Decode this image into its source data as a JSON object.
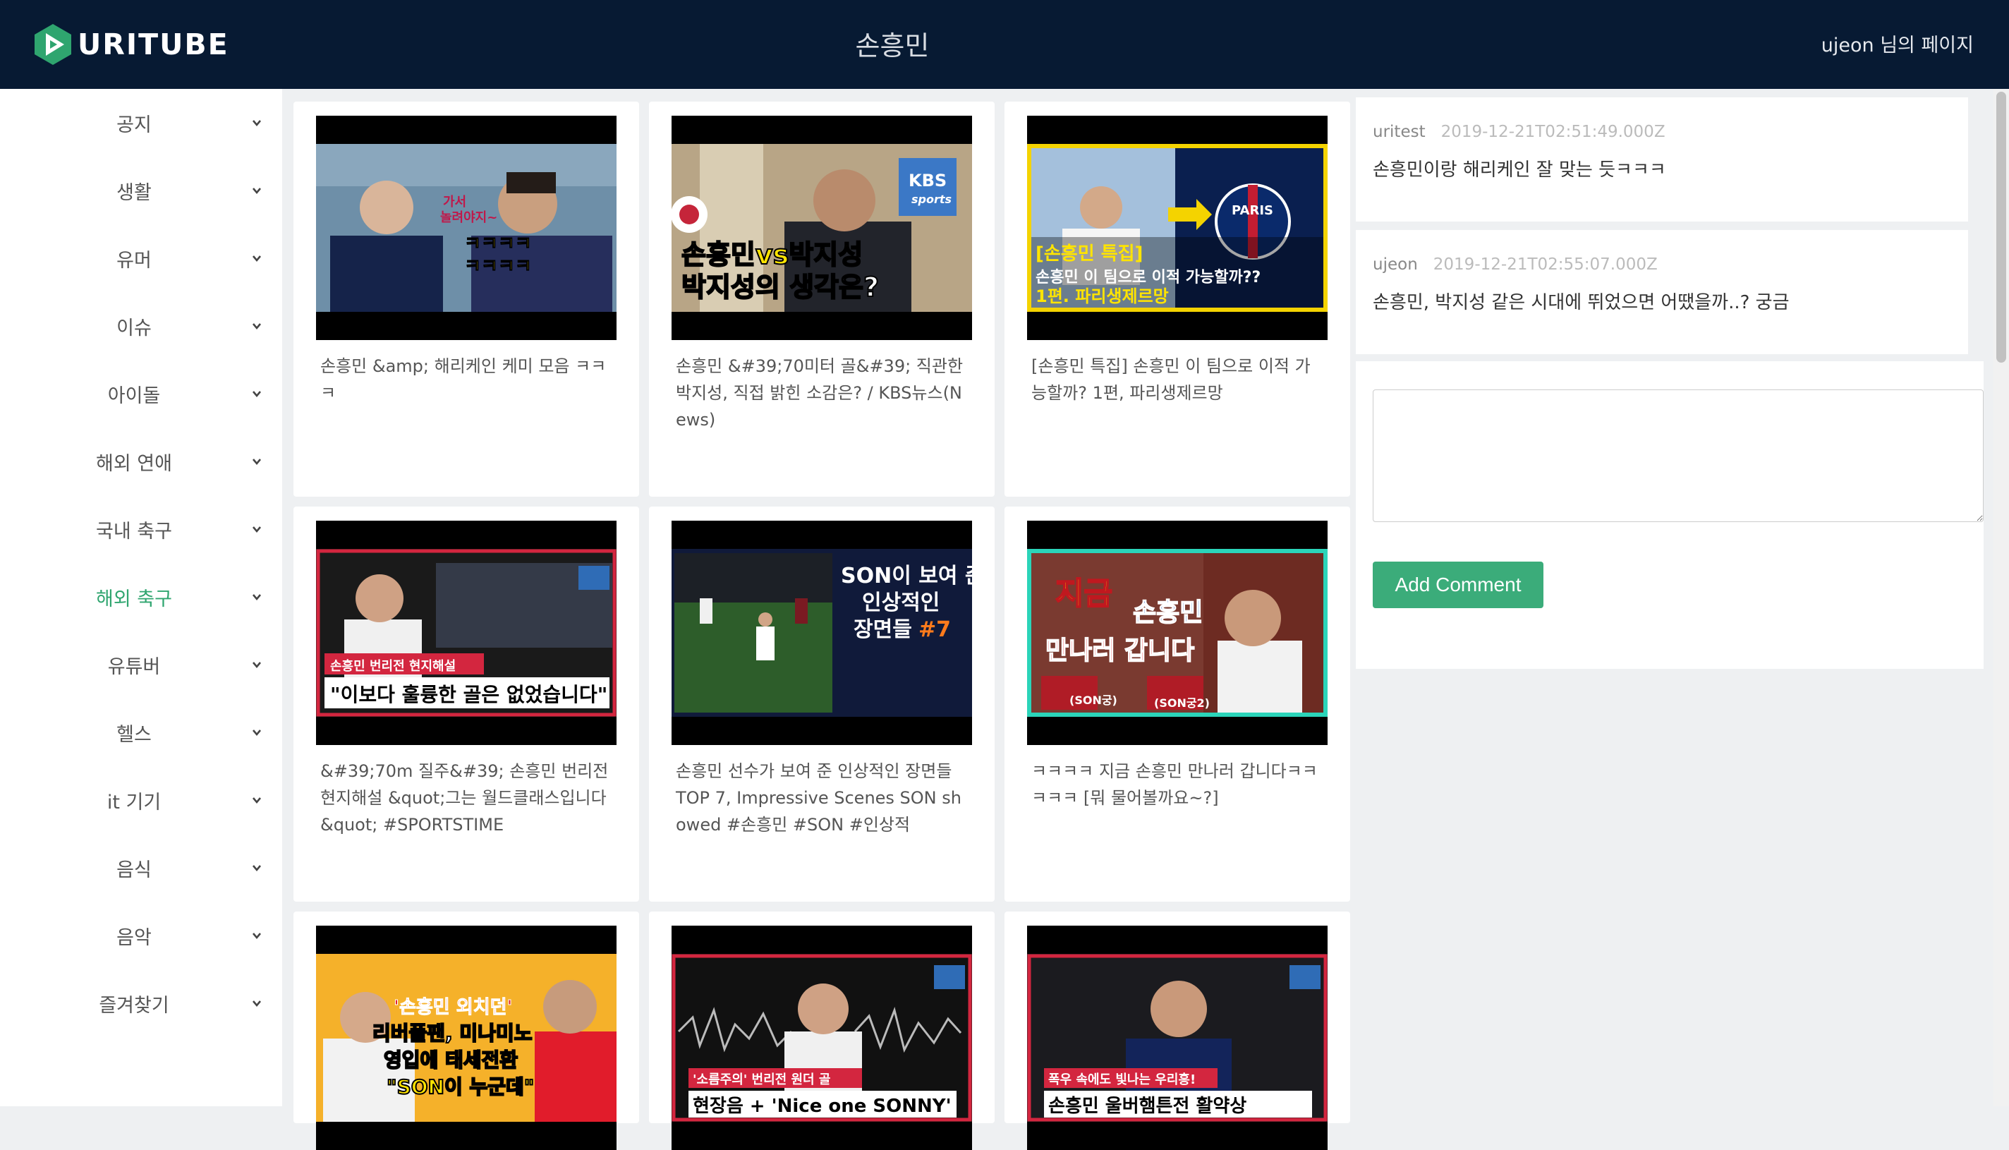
{
  "header": {
    "logo_text": "URITUBE",
    "title": "손흥민",
    "user_link": "ujeon 님의 페이지"
  },
  "sidebar": {
    "items": [
      {
        "label": "공지"
      },
      {
        "label": "생활"
      },
      {
        "label": "유머"
      },
      {
        "label": "이슈"
      },
      {
        "label": "아이돌"
      },
      {
        "label": "해외 연애"
      },
      {
        "label": "국내 축구"
      },
      {
        "label": "해외 축구",
        "active": true
      },
      {
        "label": "유튜버"
      },
      {
        "label": "헬스"
      },
      {
        "label": "it 기기"
      },
      {
        "label": "음식"
      },
      {
        "label": "음악"
      },
      {
        "label": "즐겨찾기"
      }
    ]
  },
  "videos": [
    {
      "title": "손흥민 &amp; 해리케인 케미 모음 ㅋㅋㅋ",
      "thumb_text": [
        "가서",
        "놀려야지~",
        "ㅋㅋㅋㅋ",
        "ㅋㅋㅋㅋ"
      ]
    },
    {
      "title": "손흥민 &#39;70미터 골&#39; 직관한 박지성, 직접 밝힌 소감은? / KBS뉴스(News)",
      "thumb_text": [
        "KBS",
        "sports",
        "손흥민vs박지성",
        "박지성의 생각은?"
      ]
    },
    {
      "title": "[손흥민 특집] 손흥민 이 팀으로 이적 가능할까? 1편, 파리생제르망",
      "thumb_text": [
        "[손흥민 특집]",
        "손흥민 이 팀으로 이적 가능할까??",
        "1편. 파리생제르망",
        "PARIS"
      ]
    },
    {
      "title": "&#39;70m 질주&#39; 손흥민 번리전 현지해설 &quot;그는 월드클래스입니다&quot; #SPORTSTIME",
      "thumb_text": [
        "손흥민 번리전 현지해설",
        "\"이보다 훌륭한 골은 없었습니다\""
      ]
    },
    {
      "title": "손흥민 선수가 보여 준 인상적인 장면들 TOP 7, Impressive Scenes SON showed #손흥민 #SON #인상적",
      "thumb_text": [
        "SON이 보여 준",
        "인상적인",
        "장면들",
        "#7"
      ]
    },
    {
      "title": "ㅋㅋㅋㅋ 지금 손흥민 만나러 갑니다ㅋㅋㅋㅋㅋ [뭐 물어볼까요~?]",
      "thumb_text": [
        "지금",
        "손흥민",
        "만나러 갑니다",
        "(SON궁)",
        "(SON궁2)"
      ]
    },
    {
      "title": "",
      "thumb_text": [
        "'손흥민 외치던'",
        "리버풀팬, 미나미노",
        "영입에 태세전환",
        "\"SON이 누군데\""
      ]
    },
    {
      "title": "",
      "thumb_text": [
        "'소름주의' 번리전 원더 골",
        "현장음 + 'Nice one SONNY'"
      ]
    },
    {
      "title": "",
      "thumb_text": [
        "폭우 속에도 빛나는 우리흥!",
        "손흥민 울버햄튼전 활약상"
      ]
    }
  ],
  "comments": [
    {
      "user": "uritest",
      "date": "2019-12-21T02:51:49.000Z",
      "text": "손흥민이랑 해리케인 잘 맞는 듯ㅋㅋㅋ"
    },
    {
      "user": "ujeon",
      "date": "2019-12-21T02:55:07.000Z",
      "text": "손흥민, 박지성 같은 시대에 뛰었으면 어땠을까..? 궁금"
    }
  ],
  "comment_form": {
    "textarea_value": "",
    "button_label": "Add Comment"
  },
  "colors": {
    "header_bg": "#071a33",
    "accent": "#3bac7a",
    "active_menu": "#2fa56f"
  }
}
